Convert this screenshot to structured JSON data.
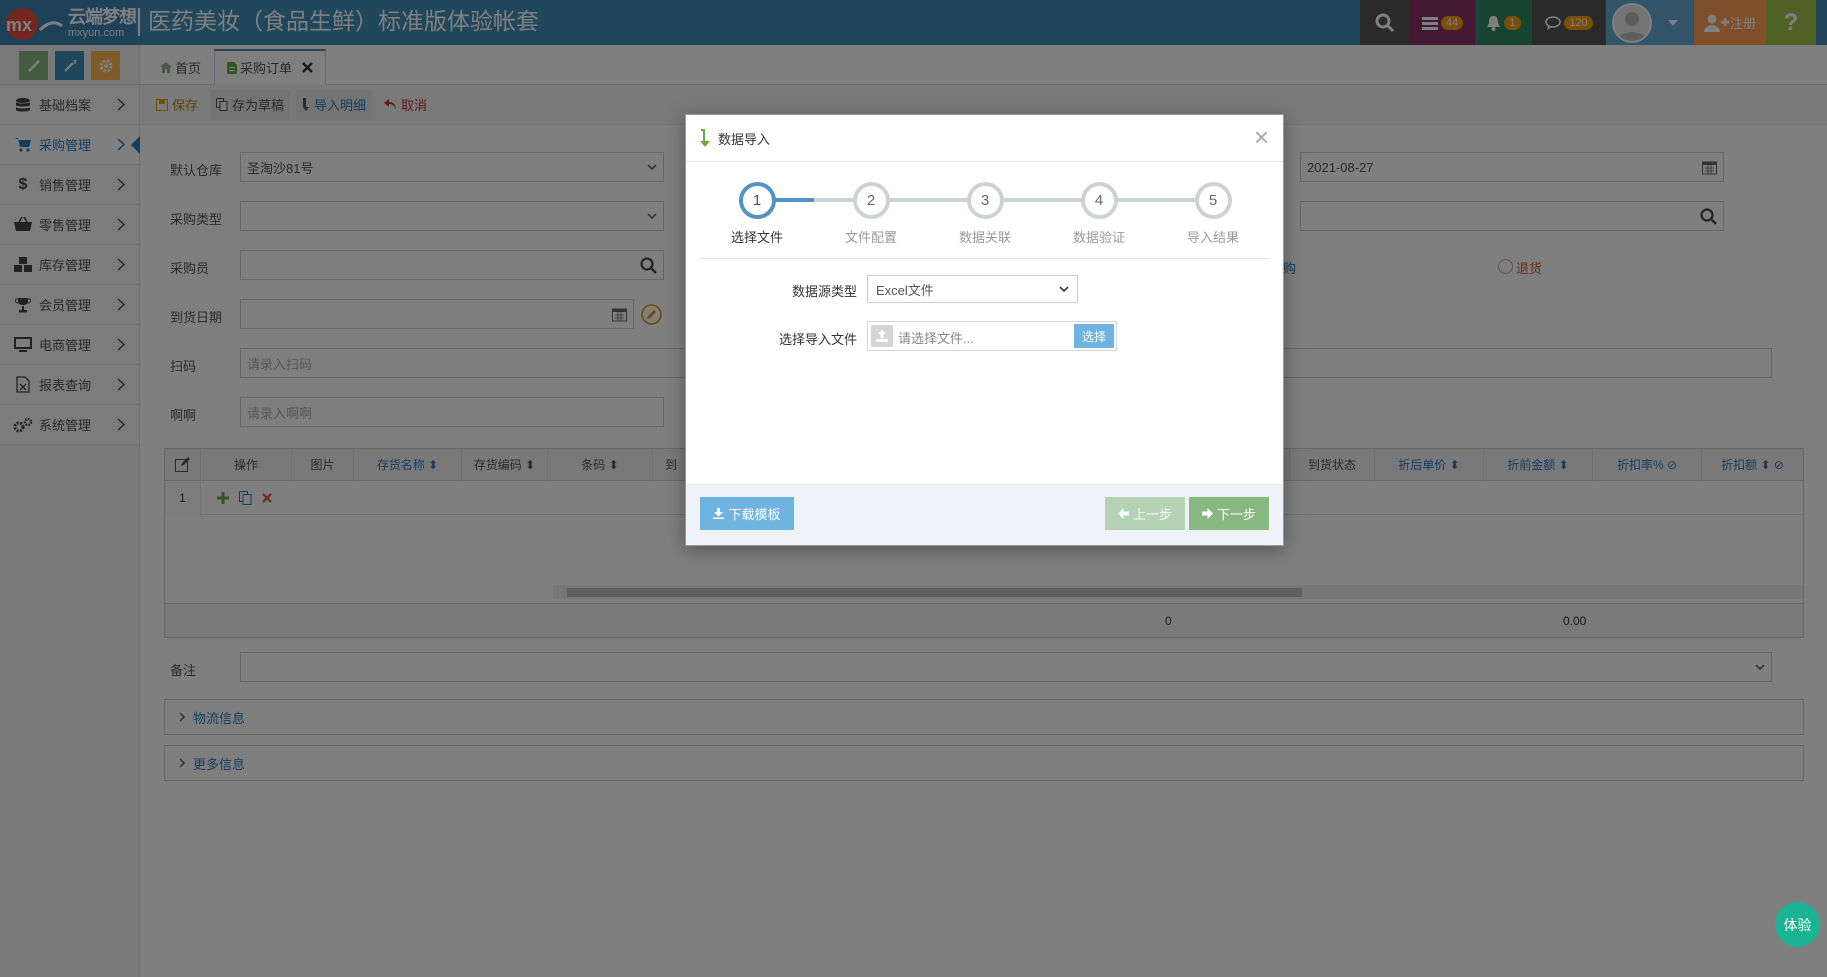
{
  "app": {
    "logo_cn": "云端梦想",
    "logo_en": "mxyun.com",
    "title": "医药美妆（食品生鲜）标准版体验帐套"
  },
  "topbar": {
    "task_count": "44",
    "notify_count": "1",
    "message_count": "120",
    "register_label": "注册",
    "colors": {
      "search": "#555555",
      "tasks": "#892e65",
      "notify": "#2e8965",
      "messages": "#555555",
      "user": "#62a8d1",
      "register": "#ff9e59",
      "help": "#a0c34c"
    }
  },
  "sidebar": {
    "items": [
      {
        "label": "基础档案",
        "icon": "database-icon"
      },
      {
        "label": "采购管理",
        "icon": "cart-icon",
        "active": true
      },
      {
        "label": "销售管理",
        "icon": "dollar-icon"
      },
      {
        "label": "零售管理",
        "icon": "basket-icon"
      },
      {
        "label": "库存管理",
        "icon": "cubes-icon"
      },
      {
        "label": "会员管理",
        "icon": "trophy-icon"
      },
      {
        "label": "电商管理",
        "icon": "desktop-icon"
      },
      {
        "label": "报表查询",
        "icon": "excel-file-icon"
      },
      {
        "label": "系统管理",
        "icon": "gears-icon"
      }
    ]
  },
  "tabs": {
    "home": "首页",
    "purchase_order": "采购订单"
  },
  "toolbar": {
    "save": "保存",
    "save_draft": "存为草稿",
    "import_detail": "导入明细",
    "cancel": "取消"
  },
  "form": {
    "warehouse_label": "默认仓库",
    "warehouse_value": "圣淘沙81号",
    "purchase_type_label": "采购类型",
    "buyer_label": "采购员",
    "arrival_date_label": "到货日期",
    "scan_label": "扫码",
    "scan_placeholder": "请录入扫码",
    "aa_label": "啊啊",
    "aa_placeholder": "请录入啊啊",
    "date_value": "2021-08-27",
    "purchase_partial": "购",
    "return_label": "退货",
    "remark_label": "备注"
  },
  "grid": {
    "headers": [
      "操作",
      "图片",
      "存货名称",
      "存货编码",
      "条码",
      "到",
      "到货状态",
      "折后单价",
      "折前金额",
      "折扣率%",
      "折扣额"
    ],
    "row_index": "1",
    "total_qty": "0",
    "total_amount": "0.00"
  },
  "sections": {
    "logistics": "物流信息",
    "more": "更多信息"
  },
  "modal": {
    "title": "数据导入",
    "steps": [
      {
        "num": "1",
        "label": "选择文件"
      },
      {
        "num": "2",
        "label": "文件配置"
      },
      {
        "num": "3",
        "label": "数据关联"
      },
      {
        "num": "4",
        "label": "数据验证"
      },
      {
        "num": "5",
        "label": "导入结果"
      }
    ],
    "source_type_label": "数据源类型",
    "source_type_value": "Excel文件",
    "file_label": "选择导入文件",
    "file_placeholder": "请选择文件...",
    "choose_button": "选择",
    "download_template": "下载模板",
    "prev": "上一步",
    "next": "下一步"
  },
  "fab": {
    "label": "体验"
  }
}
